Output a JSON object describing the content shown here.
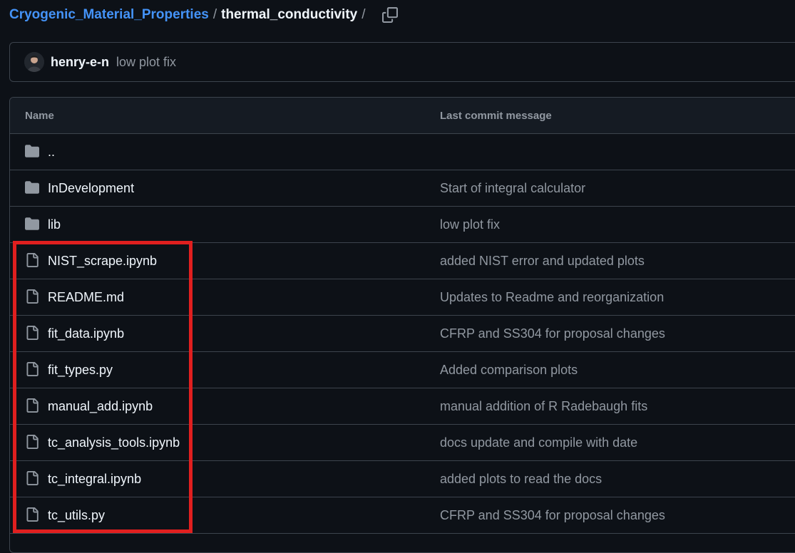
{
  "breadcrumb": {
    "repo": "Cryogenic_Material_Properties",
    "separator": "/",
    "current": "thermal_conductivity",
    "trailing_separator": "/"
  },
  "latest_commit": {
    "author": "henry-e-n",
    "message": "low plot fix"
  },
  "table": {
    "header_name": "Name",
    "header_message": "Last commit message",
    "rows": [
      {
        "type": "folder",
        "name": "..",
        "message": ""
      },
      {
        "type": "folder",
        "name": "InDevelopment",
        "message": "Start of integral calculator"
      },
      {
        "type": "folder",
        "name": "lib",
        "message": "low plot fix"
      },
      {
        "type": "file",
        "name": "NIST_scrape.ipynb",
        "message": "added NIST error and updated plots"
      },
      {
        "type": "file",
        "name": "README.md",
        "message": "Updates to Readme and reorganization"
      },
      {
        "type": "file",
        "name": "fit_data.ipynb",
        "message": "CFRP and SS304 for proposal changes"
      },
      {
        "type": "file",
        "name": "fit_types.py",
        "message": "Added comparison plots"
      },
      {
        "type": "file",
        "name": "manual_add.ipynb",
        "message": "manual addition of R Radebaugh fits"
      },
      {
        "type": "file",
        "name": "tc_analysis_tools.ipynb",
        "message": "docs update and compile with date"
      },
      {
        "type": "file",
        "name": "tc_integral.ipynb",
        "message": "added plots to read the docs"
      },
      {
        "type": "file",
        "name": "tc_utils.py",
        "message": "CFRP and SS304 for proposal changes"
      }
    ]
  },
  "icons": {
    "folder": "folder-icon",
    "file": "file-icon",
    "copy": "copy-icon"
  },
  "colors": {
    "background": "#0d1117",
    "link": "#4493f8",
    "muted": "#9198a1",
    "border": "#3d444d",
    "highlight": "#e01f1f"
  }
}
